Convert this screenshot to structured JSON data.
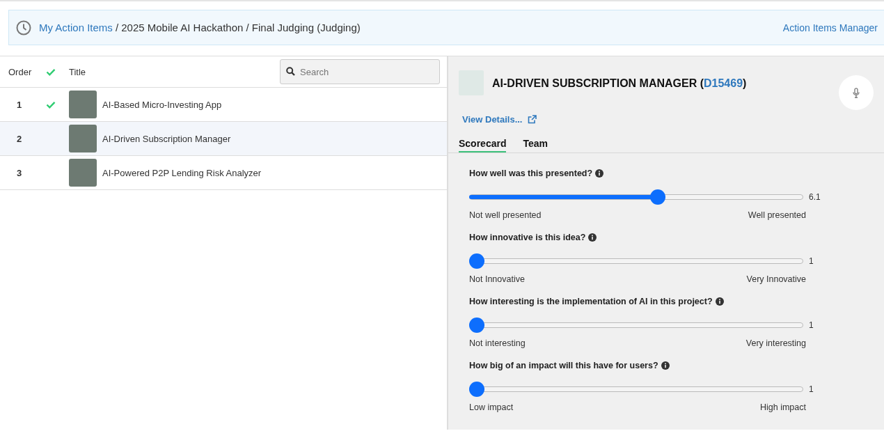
{
  "breadcrumb": {
    "link": "My Action Items",
    "path": "/ 2025 Mobile AI Hackathon / Final Judging (Judging)",
    "right_link": "Action Items Manager"
  },
  "table": {
    "columns": {
      "order": "Order",
      "title": "Title"
    },
    "search": {
      "placeholder": "Search"
    },
    "rows": [
      {
        "order": "1",
        "done": true,
        "title": "AI-Based Micro-Investing App",
        "selected": false
      },
      {
        "order": "2",
        "done": false,
        "title": "AI-Driven Subscription Manager",
        "selected": true
      },
      {
        "order": "3",
        "done": false,
        "title": "AI-Powered P2P Lending Risk Analyzer",
        "selected": false
      }
    ]
  },
  "detail": {
    "title": "AI-DRIVEN SUBSCRIPTION MANAGER",
    "id_open": "(",
    "id": "D15469",
    "id_close": ")",
    "view_details": "View Details...",
    "tabs": [
      {
        "label": "Scorecard",
        "selected": true
      },
      {
        "label": "Team",
        "selected": false
      }
    ],
    "questions": [
      {
        "question": "How well was this presented?",
        "level": 0.567,
        "reading": "6.1",
        "min_label": "Not well presented",
        "max_label": "Well presented"
      },
      {
        "question": "How innovative is this idea?",
        "level": 0,
        "reading": "1",
        "min_label": "Not Innovative",
        "max_label": "Very Innovative"
      },
      {
        "question": "How interesting is the implementation of AI in this project?",
        "level": 0,
        "reading": "1",
        "min_label": "Not interesting",
        "max_label": "Very interesting"
      },
      {
        "question": "How big of an impact will this have for users?",
        "level": 0,
        "reading": "1",
        "min_label": "Low impact",
        "max_label": "High impact"
      }
    ]
  }
}
